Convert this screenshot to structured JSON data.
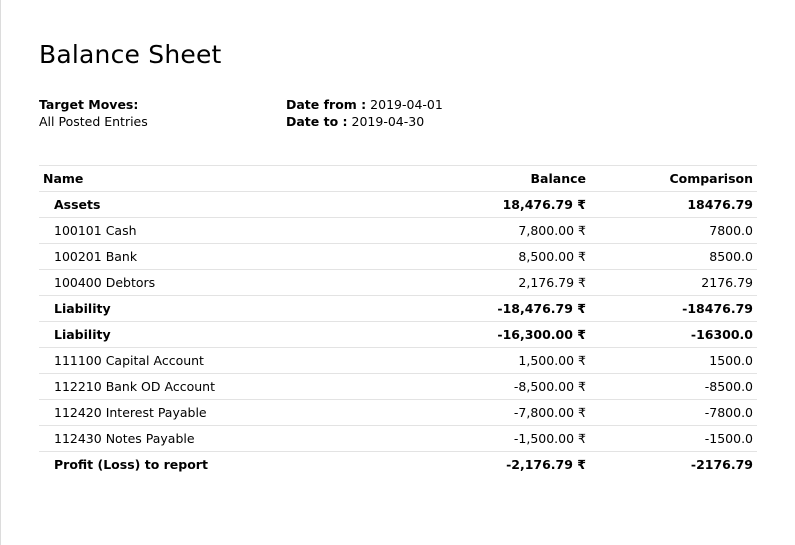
{
  "report": {
    "title": "Balance Sheet",
    "target_moves_label": "Target Moves:",
    "target_moves_value": "All Posted Entries",
    "date_from_label": "Date from :",
    "date_from_value": "2019-04-01",
    "date_to_label": "Date to :",
    "date_to_value": "2019-04-30"
  },
  "table": {
    "headers": {
      "name": "Name",
      "balance": "Balance",
      "comparison": "Comparison"
    },
    "rows": [
      {
        "name": "Assets",
        "balance": "18,476.79 ₹",
        "comparison": "18476.79",
        "bold": true
      },
      {
        "name": "100101 Cash",
        "balance": "7,800.00 ₹",
        "comparison": "7800.0",
        "bold": false
      },
      {
        "name": "100201 Bank",
        "balance": "8,500.00 ₹",
        "comparison": "8500.0",
        "bold": false
      },
      {
        "name": "100400 Debtors",
        "balance": "2,176.79 ₹",
        "comparison": "2176.79",
        "bold": false
      },
      {
        "name": "Liability",
        "balance": "-18,476.79 ₹",
        "comparison": "-18476.79",
        "bold": true
      },
      {
        "name": "Liability",
        "balance": "-16,300.00 ₹",
        "comparison": "-16300.0",
        "bold": true
      },
      {
        "name": "111100 Capital Account",
        "balance": "1,500.00 ₹",
        "comparison": "1500.0",
        "bold": false
      },
      {
        "name": "112210 Bank OD Account",
        "balance": "-8,500.00 ₹",
        "comparison": "-8500.0",
        "bold": false
      },
      {
        "name": "112420 Interest Payable",
        "balance": "-7,800.00 ₹",
        "comparison": "-7800.0",
        "bold": false
      },
      {
        "name": "112430 Notes Payable",
        "balance": "-1,500.00 ₹",
        "comparison": "-1500.0",
        "bold": false
      },
      {
        "name": "Profit (Loss) to report",
        "balance": "-2,176.79 ₹",
        "comparison": "-2176.79",
        "bold": true
      }
    ]
  }
}
